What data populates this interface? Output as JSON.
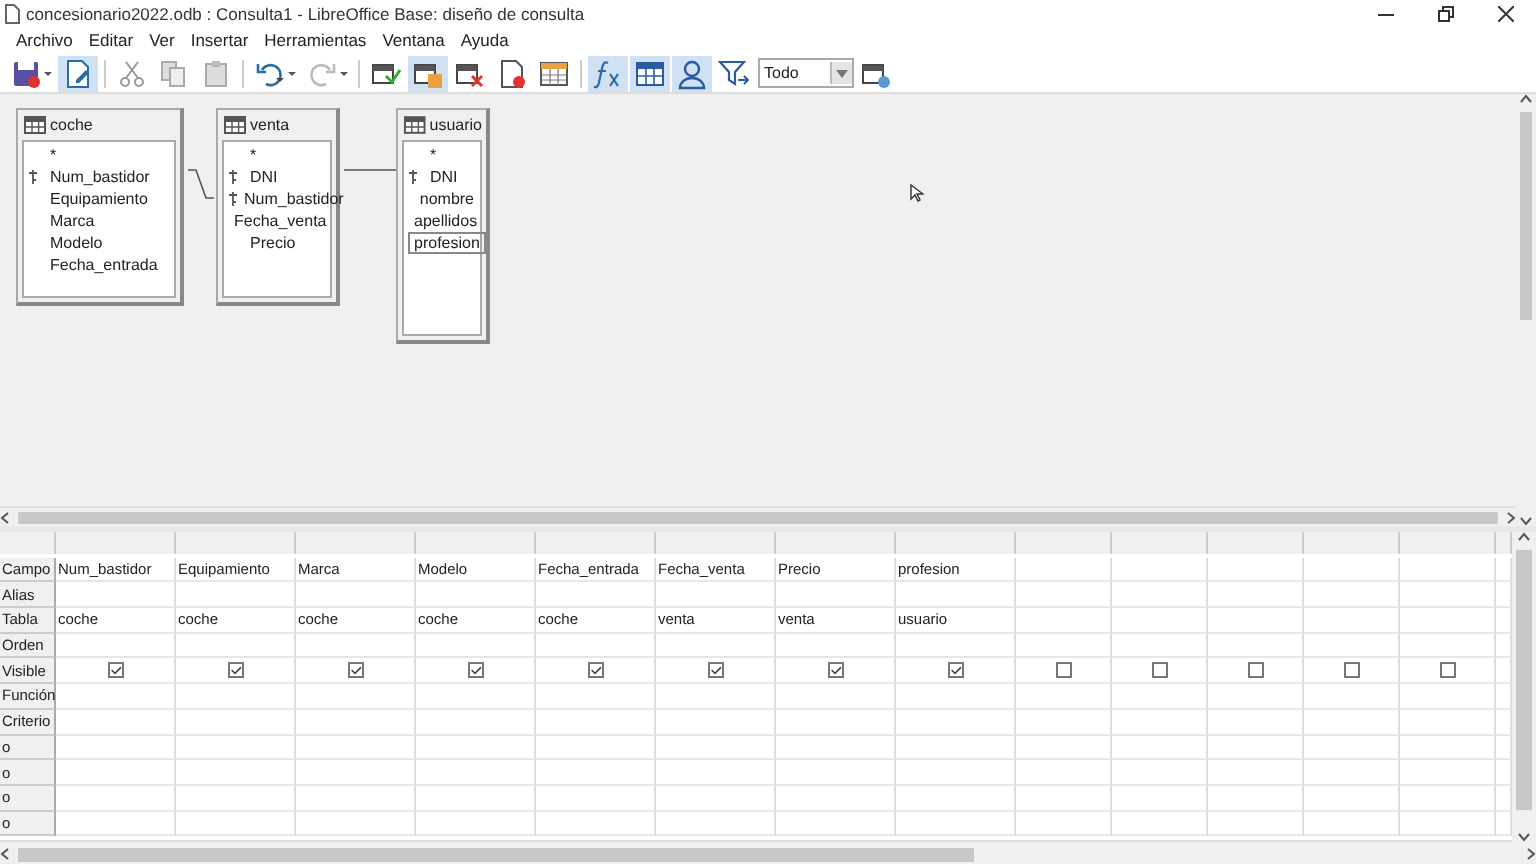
{
  "window": {
    "title": "concesionario2022.odb : Consulta1 - LibreOffice Base: diseño de consulta"
  },
  "menu": [
    "Archivo",
    "Editar",
    "Ver",
    "Insertar",
    "Herramientas",
    "Ventana",
    "Ayuda"
  ],
  "toolbar": {
    "buttons": [
      {
        "kind": "save",
        "on": false
      },
      {
        "kind": "edit",
        "on": true
      },
      {
        "kind": "cut",
        "on": false
      },
      {
        "kind": "copy",
        "on": false
      },
      {
        "kind": "paste",
        "on": false
      },
      {
        "kind": "undo",
        "on": false
      },
      {
        "kind": "redo",
        "on": false
      },
      {
        "kind": "run",
        "on": false
      },
      {
        "kind": "clear",
        "on": true
      },
      {
        "kind": "addtable",
        "on": false
      },
      {
        "kind": "sql",
        "on": false
      },
      {
        "kind": "grid",
        "on": false
      },
      {
        "kind": "function",
        "on": true
      },
      {
        "kind": "tablename",
        "on": true
      },
      {
        "kind": "alias",
        "on": true
      },
      {
        "kind": "distinct",
        "on": false
      }
    ],
    "limit": {
      "value": "Todo"
    },
    "last": {
      "kind": "filter",
      "on": false
    }
  },
  "tables": [
    {
      "name": "coche",
      "fields": [
        {
          "name": "*",
          "key": false,
          "selected": false
        },
        {
          "name": "Num_bastidor",
          "key": true,
          "selected": false
        },
        {
          "name": "Equipamiento",
          "key": false,
          "selected": false
        },
        {
          "name": "Marca",
          "key": false,
          "selected": false
        },
        {
          "name": "Modelo",
          "key": false,
          "selected": false
        },
        {
          "name": "Fecha_entrada",
          "key": false,
          "selected": false
        }
      ]
    },
    {
      "name": "venta",
      "fields": [
        {
          "name": "*",
          "key": false,
          "selected": false
        },
        {
          "name": "DNI",
          "key": true,
          "selected": false
        },
        {
          "name": "Num_bastidor",
          "key": true,
          "selected": false
        },
        {
          "name": "Fecha_venta",
          "key": false,
          "selected": false
        },
        {
          "name": "Precio",
          "key": false,
          "selected": false
        }
      ]
    },
    {
      "name": "usuario",
      "fields": [
        {
          "name": "*",
          "key": false,
          "selected": false
        },
        {
          "name": "DNI",
          "key": true,
          "selected": false
        },
        {
          "name": "nombre",
          "key": false,
          "selected": false
        },
        {
          "name": "apellidos",
          "key": false,
          "selected": false
        },
        {
          "name": "profesion",
          "key": false,
          "selected": true
        }
      ]
    }
  ],
  "grid": {
    "row_labels": [
      "Campo",
      "Alias",
      "Tabla",
      "Orden",
      "Visible",
      "Función",
      "Criterio",
      "o",
      "o",
      "o",
      "o"
    ],
    "columns": [
      {
        "campo": "Num_bastidor",
        "tabla": "coche",
        "visible": true
      },
      {
        "campo": "Equipamiento",
        "tabla": "coche",
        "visible": true
      },
      {
        "campo": "Marca",
        "tabla": "coche",
        "visible": true
      },
      {
        "campo": "Modelo",
        "tabla": "coche",
        "visible": true
      },
      {
        "campo": "Fecha_entrada",
        "tabla": "coche",
        "visible": true
      },
      {
        "campo": "Fecha_venta",
        "tabla": "venta",
        "visible": true
      },
      {
        "campo": "Precio",
        "tabla": "venta",
        "visible": true
      },
      {
        "campo": "profesion",
        "tabla": "usuario",
        "visible": true
      },
      {
        "visible": false
      },
      {
        "visible": false
      },
      {
        "visible": false
      },
      {
        "visible": false
      },
      {
        "visible": false
      }
    ]
  }
}
